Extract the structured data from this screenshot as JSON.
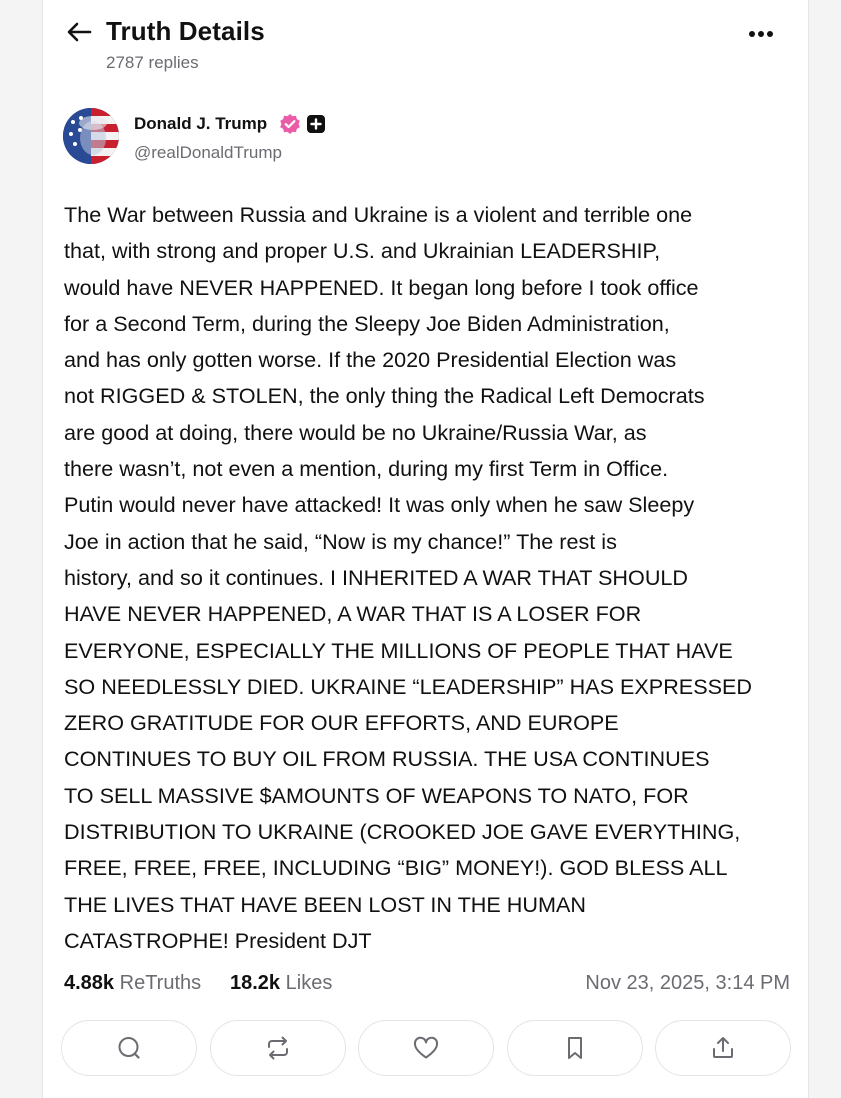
{
  "header": {
    "title": "Truth Details",
    "reply_count": "2787 replies",
    "back_icon": "arrow-left-icon",
    "more_icon": "more-horizontal-icon"
  },
  "post": {
    "author": {
      "name": "Donald J. Trump",
      "handle": "@realDonaldTrump",
      "verified_icon": "verified-badge-icon",
      "plus_icon": "plus-badge-icon",
      "verified_color": "#ea5ba8"
    },
    "text": "The War between Russia and Ukraine is a violent and terrible one that, with strong and proper U.S. and Ukrainian LEADERSHIP, would have NEVER HAPPENED. It began long before I took office for a Second Term, during the Sleepy Joe Biden Administration, and has only gotten worse. If the 2020 Presidential Election was not RIGGED & STOLEN, the only thing the Radical Left Democrats are good at doing, there would be no Ukraine/Russia War, as there wasn’t, not even a mention, during my first Term in Office. Putin would never have attacked! It was only when he saw Sleepy Joe in action that he said, “Now is my chance!” The rest is history, and so it continues. I INHERITED A WAR THAT SHOULD HAVE NEVER HAPPENED, A WAR THAT IS A LOSER FOR EVERYONE, ESPECIALLY THE MILLIONS OF PEOPLE THAT HAVE SO NEEDLESSLY DIED. UKRAINE “LEADERSHIP” HAS EXPRESSED ZERO GRATITUDE FOR OUR EFFORTS, AND EUROPE CONTINUES TO BUY OIL FROM RUSSIA. THE USA CONTINUES TO SELL MASSIVE $AMOUNTS OF WEAPONS TO NATO, FOR DISTRIBUTION TO UKRAINE (CROOKED JOE GAVE EVERYTHING, FREE, FREE, FREE, INCLUDING “BIG” MONEY!). GOD BLESS ALL THE LIVES THAT HAVE BEEN LOST IN THE HUMAN CATASTROPHE! President DJT",
    "lines": [
      "The War between Russia and Ukraine is a violent and terrible one",
      "that, with strong and proper U.S. and Ukrainian LEADERSHIP,",
      "would have NEVER HAPPENED. It began long before I took office",
      "for a Second Term, during the Sleepy Joe Biden Administration,",
      "and has only gotten worse. If the 2020 Presidential Election was",
      "not RIGGED & STOLEN, the only thing the Radical Left Democrats",
      "are good at doing, there would be no Ukraine/Russia War, as",
      "there wasn’t, not even a mention, during my first Term in Office.",
      "Putin would never have attacked! It was only when he saw Sleepy",
      "Joe in action that he said, “Now is my chance!” The rest is",
      "history, and so it continues. I INHERITED A WAR THAT SHOULD",
      "HAVE NEVER HAPPENED, A WAR THAT IS A LOSER FOR",
      "EVERYONE, ESPECIALLY THE MILLIONS OF PEOPLE THAT HAVE",
      "SO NEEDLESSLY DIED. UKRAINE “LEADERSHIP” HAS EXPRESSED",
      "ZERO GRATITUDE FOR OUR EFFORTS, AND EUROPE",
      "CONTINUES TO BUY OIL FROM RUSSIA. THE USA CONTINUES",
      "TO SELL MASSIVE $AMOUNTS OF WEAPONS TO NATO, FOR",
      "DISTRIBUTION TO UKRAINE (CROOKED JOE GAVE EVERYTHING,",
      "FREE, FREE, FREE, INCLUDING “BIG” MONEY!). GOD BLESS ALL",
      "THE LIVES THAT HAVE BEEN LOST IN THE HUMAN",
      "CATASTROPHE! President DJT"
    ],
    "stats": {
      "retruths_count": "4.88k",
      "retruths_label": "ReTruths",
      "likes_count": "18.2k",
      "likes_label": "Likes",
      "timestamp": "Nov 23, 2025, 3:14 PM"
    }
  },
  "actions": [
    {
      "name": "reply",
      "icon": "comment-icon"
    },
    {
      "name": "retruth",
      "icon": "repost-icon"
    },
    {
      "name": "like",
      "icon": "heart-icon"
    },
    {
      "name": "bookmark",
      "icon": "bookmark-icon"
    },
    {
      "name": "share",
      "icon": "share-icon"
    }
  ],
  "colors": {
    "text_primary": "#111111",
    "text_secondary": "#6b6b72",
    "border": "#e4e4e8",
    "verified": "#ea5ba8"
  }
}
